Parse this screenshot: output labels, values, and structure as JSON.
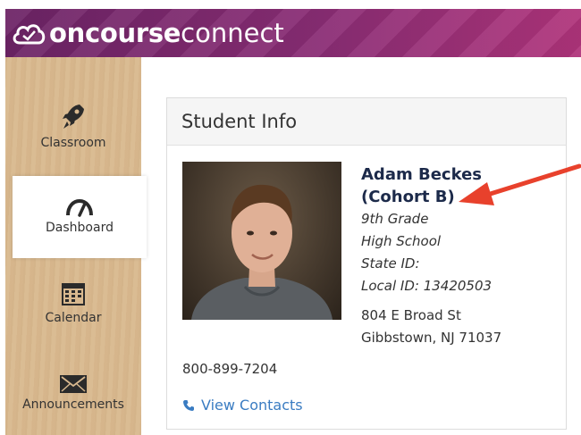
{
  "app": {
    "brand_bold": "oncourse",
    "brand_light": "connect",
    "logo_icon": "cloud-check-icon"
  },
  "sidebar": {
    "items": [
      {
        "label": "Classroom",
        "icon": "rocket-icon"
      },
      {
        "label": "Dashboard",
        "icon": "speedometer-icon",
        "active": true
      },
      {
        "label": "Calendar",
        "icon": "calendar-icon"
      },
      {
        "label": "Announcements",
        "icon": "envelope-icon"
      }
    ]
  },
  "student_card": {
    "title": "Student Info",
    "name_line1": "Adam Beckes",
    "name_line2": "(Cohort B)",
    "grade": "9th Grade",
    "school": "High School",
    "state_id": "State ID:",
    "local_id": "Local ID: 13420503",
    "address_line1": "804 E Broad St",
    "address_line2": "Gibbstown, NJ 71037",
    "phone": "800-899-7204",
    "view_contacts": "View Contacts"
  },
  "colors": {
    "header_purple": "#7a2a6e",
    "name_navy": "#1c2a4a",
    "link_blue": "#3a7cc2",
    "annotation_arrow": "#e8412c"
  }
}
